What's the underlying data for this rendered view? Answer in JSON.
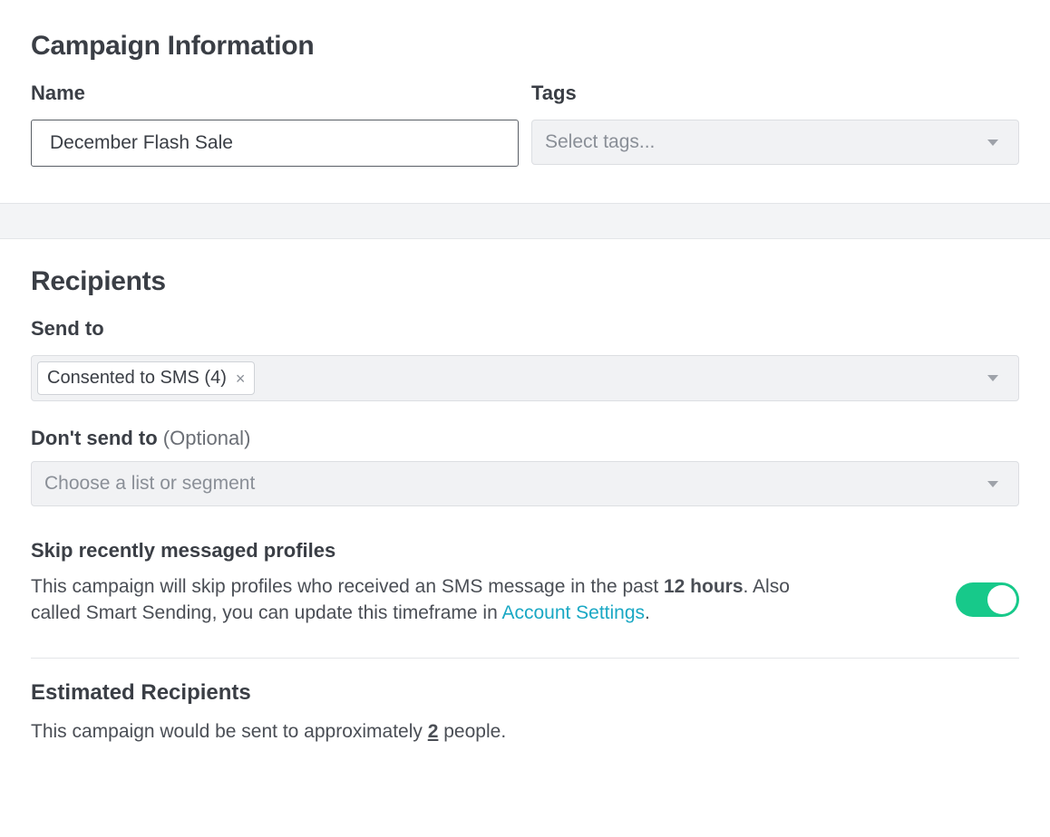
{
  "campaign_info": {
    "title": "Campaign Information",
    "name_label": "Name",
    "name_value": "December Flash Sale",
    "tags_label": "Tags",
    "tags_placeholder": "Select tags..."
  },
  "recipients": {
    "title": "Recipients",
    "send_to_label": "Send to",
    "send_to_chip": "Consented to SMS (4)",
    "chip_close": "×",
    "dont_send_label": "Don't send to",
    "dont_send_optional": "(Optional)",
    "dont_send_placeholder": "Choose a list or segment",
    "skip_label": "Skip recently messaged profiles",
    "skip_desc_1": "This campaign will skip profiles who received an SMS message in the past ",
    "skip_hours": "12 hours",
    "skip_desc_2": ". Also called Smart Sending, you can update this timeframe in ",
    "skip_link": "Account Settings",
    "skip_desc_3": ".",
    "estimated_title": "Estimated Recipients",
    "estimated_desc_1": "This campaign would be sent to approximately ",
    "estimated_count": "2",
    "estimated_desc_2": " people."
  }
}
